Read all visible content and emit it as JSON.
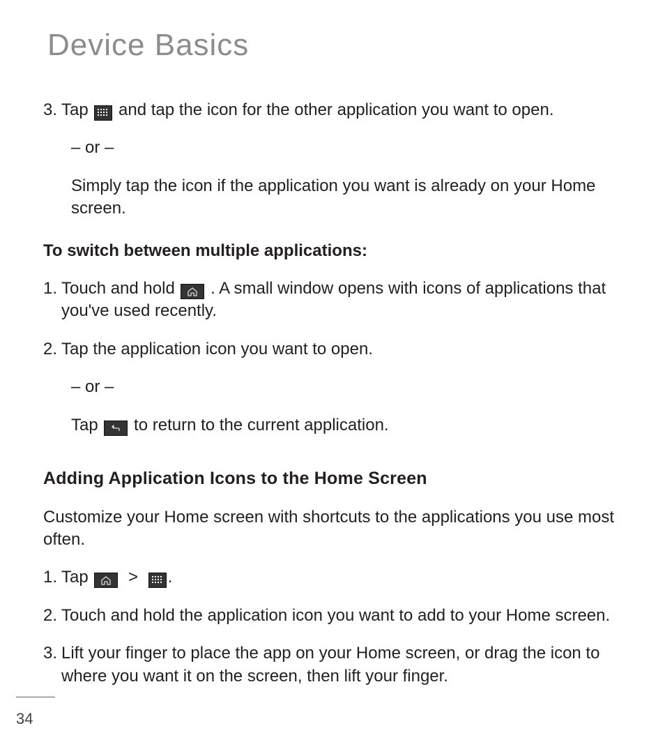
{
  "title": "Device Basics",
  "step3": {
    "num": "3.",
    "pre": "Tap ",
    "post": " and tap the icon for the other application you want to open."
  },
  "or": "– or –",
  "step3_alt": "Simply tap the icon if the application you want is already on your Home screen.",
  "switch_heading": "To switch between multiple applications:",
  "switch1": {
    "num": "1.",
    "pre": "Touch and hold  ",
    "post": ". A small window opens with icons of applications that you've used recently."
  },
  "switch2": {
    "num": "2.",
    "text": "Tap the application icon you want to open."
  },
  "switch2_alt_pre": "Tap  ",
  "switch2_alt_post": " to return to the current application.",
  "add_heading": "Adding Application Icons to the Home Screen",
  "add_intro": "Customize your Home screen with shortcuts to the applications you use most often.",
  "add1": {
    "num": "1.",
    "pre": "Tap  ",
    "sep": ">",
    "post": "."
  },
  "add2": {
    "num": "2.",
    "text": "Touch and hold the application icon you want to add to your Home screen."
  },
  "add3": {
    "num": "3.",
    "text": "Lift your finger to place the app on your Home screen, or drag the icon to where you want it on the screen, then lift your finger."
  },
  "page_number": "34",
  "icons": {
    "apps": "apps-grid-icon",
    "home": "home-icon",
    "back": "back-icon"
  }
}
